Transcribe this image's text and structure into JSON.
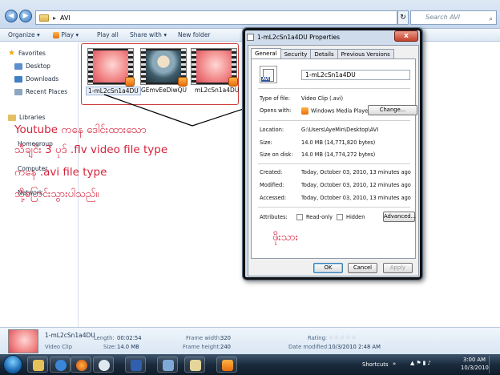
{
  "address": {
    "crumbs": [
      "AVI"
    ],
    "search_placeholder": "Search AVI"
  },
  "toolbar": {
    "organize": "Organize ▾",
    "play": "Play ▾",
    "play_all": "Play all",
    "share_with": "Share with ▾",
    "new_folder": "New folder"
  },
  "navpane": {
    "favorites": "Favorites",
    "desktop": "Desktop",
    "downloads": "Downloads",
    "recent": "Recent Places",
    "libraries": "Libraries",
    "homegroup": "Homegroup",
    "computer": "Computer",
    "network": "Network"
  },
  "files": [
    {
      "name": "1-mL2cSn1a4DU"
    },
    {
      "name": "GEmvEeDiwQU"
    },
    {
      "name": "mL2cSn1a4DU"
    }
  ],
  "annotations": {
    "line1": "Youtube ကနေ ဒေါင်းထားသော",
    "line2": "သီချင်း 3 ပုဒ် .flv video file type",
    "line3": "ကနေ .avi file type",
    "line4": "သို့ပြောင်းသွားပါသည်။",
    "signature": "ဖိုးသား"
  },
  "dialog": {
    "title": "1-mL2cSn1a4DU Properties",
    "close": "x",
    "tabs": [
      "General",
      "Security",
      "Details",
      "Previous Versions"
    ],
    "file_name": "1-mL2cSn1a4DU",
    "type_label": "Type of file:",
    "type_value": "Video Clip (.avi)",
    "opens_label": "Opens with:",
    "opens_value": "Windows Media Player",
    "change_btn": "Change...",
    "location_label": "Location:",
    "location_value": "G:\\Users\\AyeMin\\Desktop\\AVI",
    "size_label": "Size:",
    "size_value": "14.0 MB (14,771,820 bytes)",
    "disk_label": "Size on disk:",
    "disk_value": "14.0 MB (14,774,272 bytes)",
    "created_label": "Created:",
    "created_value": "Today, October 03, 2010, 13 minutes ago",
    "modified_label": "Modified:",
    "modified_value": "Today, October 03, 2010, 12 minutes ago",
    "accessed_label": "Accessed:",
    "accessed_value": "Today, October 03, 2010, 13 minutes ago",
    "attributes_label": "Attributes:",
    "readonly": "Read-only",
    "hidden": "Hidden",
    "advanced_btn": "Advanced...",
    "ok": "OK",
    "cancel": "Cancel",
    "apply": "Apply"
  },
  "details": {
    "name": "1-mL2cSn1a4DU",
    "type": "Video Clip",
    "length_label": "Length:",
    "length_value": "00:02:54",
    "size_label": "Size:",
    "size_value": "14.0 MB",
    "fw_label": "Frame width:",
    "fw_value": "320",
    "fh_label": "Frame height:",
    "fh_value": "240",
    "rating_label": "Rating:",
    "rating_value": "☆☆☆☆☆",
    "dm_label": "Date modified:",
    "dm_value": "10/3/2010 2:48 AM"
  },
  "taskbar": {
    "shortcuts": "Shortcuts",
    "time": "3:00 AM",
    "date": "10/3/2010"
  }
}
